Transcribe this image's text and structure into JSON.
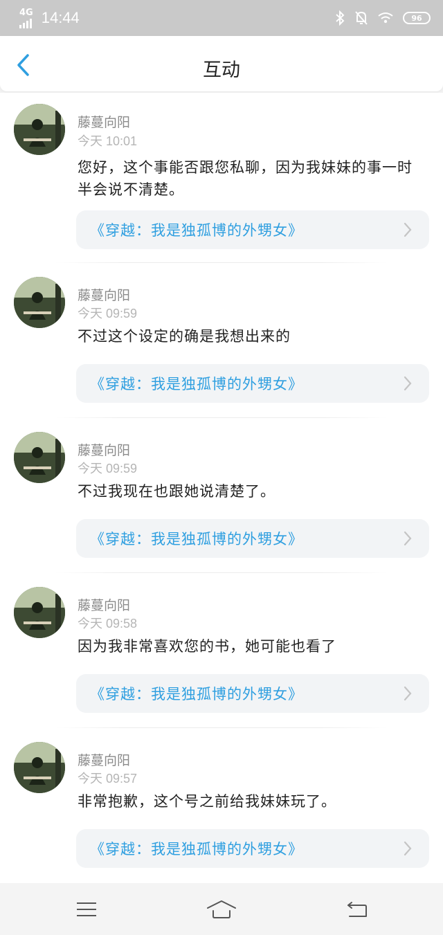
{
  "status_bar": {
    "network": "4G",
    "time": "14:44",
    "battery": "96"
  },
  "header": {
    "title": "互动"
  },
  "items": [
    {
      "username": "藤蔓向阳",
      "time": "今天 10:01",
      "message": "您好，这个事能否跟您私聊，因为我妹妹的事一时半会说不清楚。",
      "book": "《穿越：我是独孤博的外甥女》"
    },
    {
      "username": "藤蔓向阳",
      "time": "今天 09:59",
      "message": "不过这个设定的确是我想出来的",
      "book": "《穿越：我是独孤博的外甥女》"
    },
    {
      "username": "藤蔓向阳",
      "time": "今天 09:59",
      "message": "不过我现在也跟她说清楚了。",
      "book": "《穿越：我是独孤博的外甥女》"
    },
    {
      "username": "藤蔓向阳",
      "time": "今天 09:58",
      "message": "因为我非常喜欢您的书，她可能也看了",
      "book": "《穿越：我是独孤博的外甥女》"
    },
    {
      "username": "藤蔓向阳",
      "time": "今天 09:57",
      "message": "非常抱歉，这个号之前给我妹妹玩了。",
      "book": "《穿越：我是独孤博的外甥女》"
    }
  ],
  "colors": {
    "accent": "#2f9fe0",
    "status_bar": "#c9c9c9"
  }
}
